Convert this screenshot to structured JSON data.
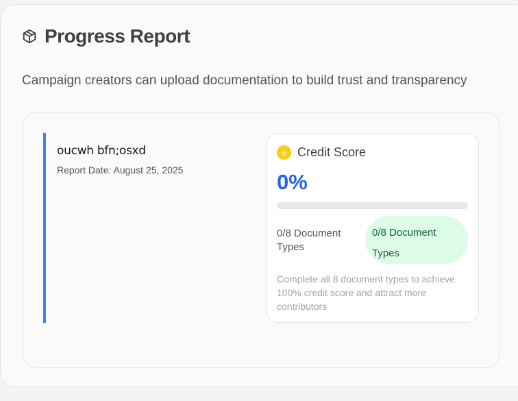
{
  "header": {
    "title": "Progress Report",
    "icon": "cube-icon",
    "subtitle": "Campaign creators can upload documentation to build trust and transparency"
  },
  "report": {
    "title": "oucwh bfn;osxd",
    "date": "Report Date: August 25, 2025",
    "accent_color": "#3b82f6"
  },
  "credit": {
    "icon": "star-icon",
    "title": "Credit Score",
    "score_text": "0%",
    "progress_percent": 0,
    "doc_count_label": "0/8 Document Types",
    "doc_badge_label": "0/8 Document Types",
    "hint": "Complete all 8 document types to achieve 100% credit score and attract more contributors",
    "score_color": "#2563eb",
    "badge_bg": "#dcfce7"
  }
}
